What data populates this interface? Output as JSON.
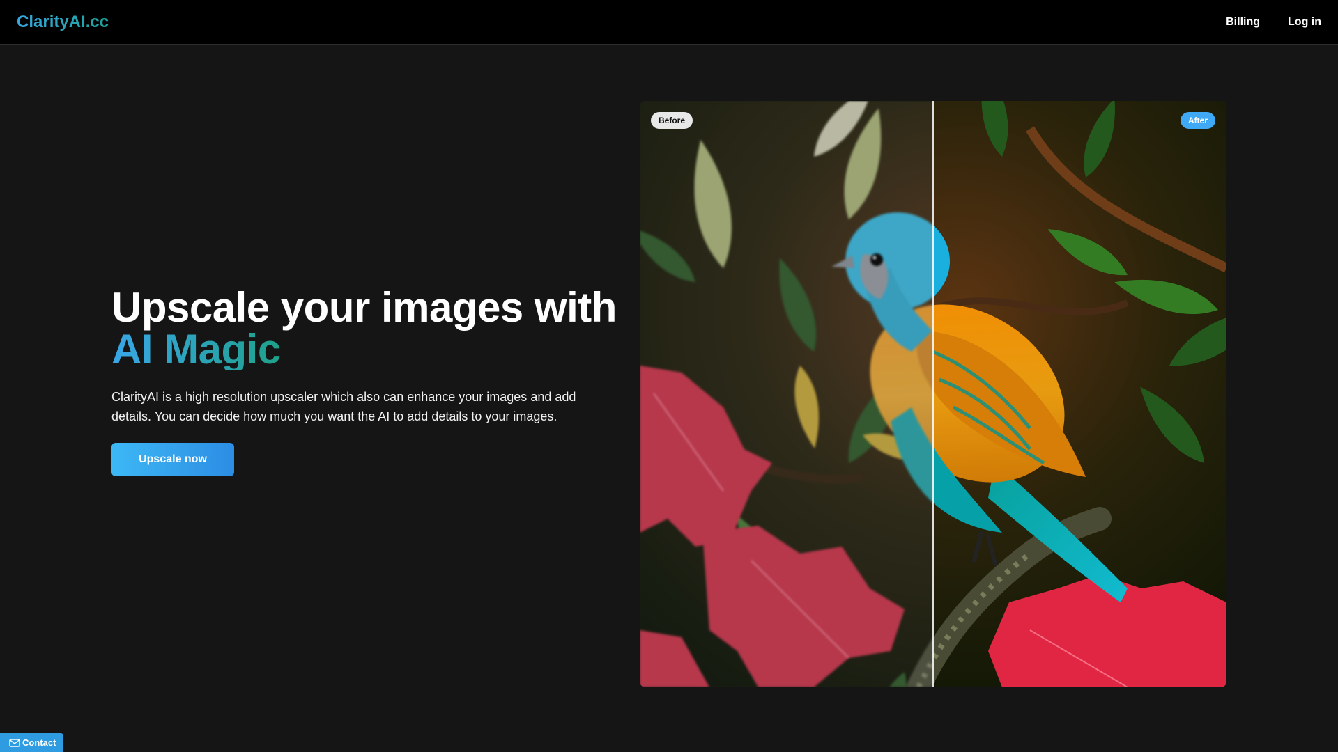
{
  "header": {
    "logo": "ClarityAI.cc",
    "nav": {
      "billing": "Billing",
      "login": "Log in"
    }
  },
  "hero": {
    "title_line1": "Upscale your images with",
    "title_line2": "AI Magic",
    "description": "ClarityAI is a high resolution upscaler which also can enhance your images and add details. You can decide how much you want the AI to add details to your images.",
    "cta_label": "Upscale now"
  },
  "compare": {
    "before_label": "Before",
    "after_label": "After",
    "split_position": 0.5
  },
  "contact": {
    "label": "Contact",
    "icon": "mail-icon"
  },
  "colors": {
    "background": "#151515",
    "header": "#000000",
    "accent_blue": "#3fa9f5",
    "accent_teal": "#1fa18a"
  }
}
